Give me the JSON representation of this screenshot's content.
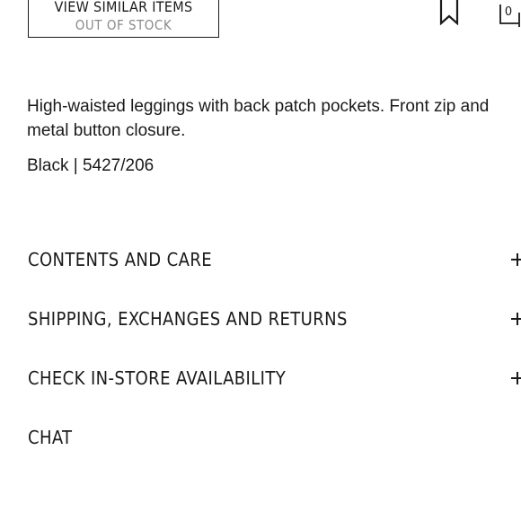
{
  "top_actions": {
    "view_similar_label": "VIEW SIMILAR ITEMS",
    "stock_status": "OUT OF STOCK",
    "cart_count": "0"
  },
  "product": {
    "description": "High-waisted leggings with back patch pockets. Front zip and metal button closure.",
    "color_and_ref": "Black | 5427/206"
  },
  "accordion": {
    "items": [
      {
        "label": "CONTENTS AND CARE",
        "expandable": true
      },
      {
        "label": "SHIPPING, EXCHANGES AND RETURNS",
        "expandable": true
      },
      {
        "label": "CHECK IN-STORE AVAILABILITY",
        "expandable": true
      },
      {
        "label": "CHAT",
        "expandable": false
      }
    ]
  },
  "colors": {
    "text": "#1a1a1a",
    "muted": "#8a8a8a",
    "background": "#ffffff"
  },
  "icons": {
    "bookmark": "bookmark-icon",
    "cart": "shopping-bag-icon",
    "expand": "plus-icon"
  }
}
